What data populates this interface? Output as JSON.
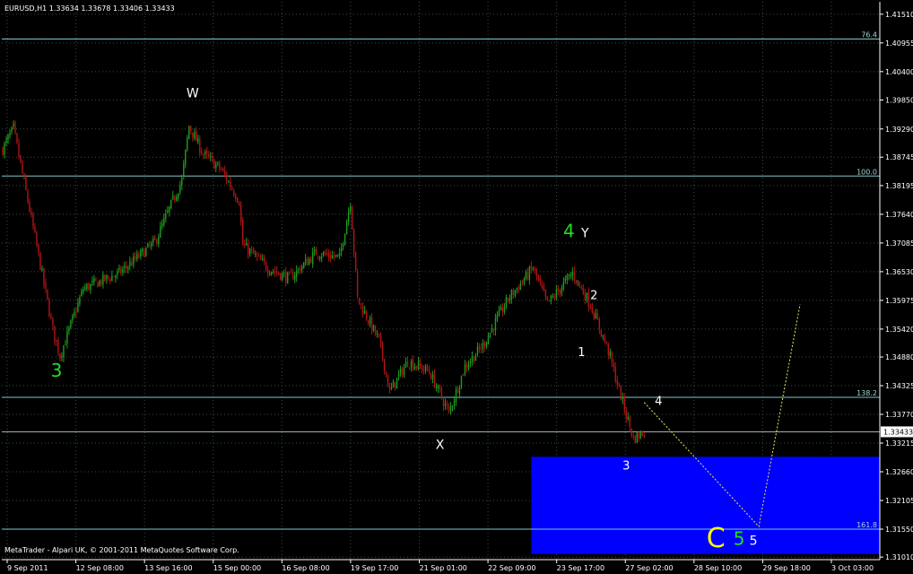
{
  "window": {
    "title": "EURUSD,H1  1.33634 1.33678 1.33406 1.33433",
    "copyright": "MetaTrader - Alpari UK, © 2001-2011 MetaQuotes Software Corp."
  },
  "colors": {
    "background": "#000000",
    "axis": "#ffffff",
    "grid": "#3a4a4a",
    "bull_candle": "#1e9c1e",
    "bear_candle": "#b01515",
    "fib_line": "#7fc8c8",
    "target_zone": "#0000ff",
    "projection": "#e8e860",
    "wave_green": "#22dd22",
    "wave_white": "#ffffff",
    "wave_yellow": "#ffff00"
  },
  "chart_data": {
    "type": "candlestick",
    "symbol": "EURUSD",
    "timeframe": "H1",
    "ylim": [
      1.3096,
      1.4175
    ],
    "y_ticks": [
      "1.41510",
      "1.40955",
      "1.40400",
      "1.39850",
      "1.39290",
      "1.38745",
      "1.38195",
      "1.37640",
      "1.37085",
      "1.36530",
      "1.35975",
      "1.35420",
      "1.34880",
      "1.34325",
      "1.33770",
      "1.33215",
      "1.32660",
      "1.32105",
      "1.31550",
      "1.31010"
    ],
    "x_ticks": [
      "9 Sep 2011",
      "12 Sep 08:00",
      "13 Sep 16:00",
      "15 Sep 00:00",
      "16 Sep 08:00",
      "19 Sep 17:00",
      "21 Sep 01:00",
      "22 Sep 09:00",
      "23 Sep 17:00",
      "27 Sep 02:00",
      "28 Sep 10:00",
      "29 Sep 18:00",
      "3 Oct 03:00"
    ],
    "current_price": "1.33433",
    "fib_levels": [
      {
        "label": "76.4",
        "price": 1.4103
      },
      {
        "label": "100.0",
        "price": 1.3838
      },
      {
        "label": "138.2",
        "price": 1.341
      },
      {
        "label": "161.8",
        "price": 1.3155
      }
    ],
    "target_zone": {
      "price_top": 1.3295,
      "price_bottom": 1.3107,
      "start_bar": 295
    },
    "anchors": [
      {
        "bar": 0,
        "price": 1.389
      },
      {
        "bar": 6,
        "price": 1.393
      },
      {
        "bar": 18,
        "price": 1.372
      },
      {
        "bar": 28,
        "price": 1.354
      },
      {
        "bar": 32,
        "price": 1.349
      },
      {
        "bar": 45,
        "price": 1.362
      },
      {
        "bar": 65,
        "price": 1.365
      },
      {
        "bar": 85,
        "price": 1.371
      },
      {
        "bar": 100,
        "price": 1.383
      },
      {
        "bar": 104,
        "price": 1.3935
      },
      {
        "bar": 112,
        "price": 1.388
      },
      {
        "bar": 122,
        "price": 1.385
      },
      {
        "bar": 132,
        "price": 1.379
      },
      {
        "bar": 134,
        "price": 1.3705
      },
      {
        "bar": 148,
        "price": 1.366
      },
      {
        "bar": 160,
        "price": 1.364
      },
      {
        "bar": 175,
        "price": 1.369
      },
      {
        "bar": 188,
        "price": 1.368
      },
      {
        "bar": 194,
        "price": 1.379
      },
      {
        "bar": 198,
        "price": 1.36
      },
      {
        "bar": 210,
        "price": 1.352
      },
      {
        "bar": 216,
        "price": 1.342
      },
      {
        "bar": 226,
        "price": 1.348
      },
      {
        "bar": 238,
        "price": 1.346
      },
      {
        "bar": 249,
        "price": 1.338
      },
      {
        "bar": 258,
        "price": 1.347
      },
      {
        "bar": 268,
        "price": 1.351
      },
      {
        "bar": 282,
        "price": 1.36
      },
      {
        "bar": 296,
        "price": 1.366
      },
      {
        "bar": 304,
        "price": 1.359
      },
      {
        "bar": 318,
        "price": 1.365
      },
      {
        "bar": 328,
        "price": 1.359
      },
      {
        "bar": 338,
        "price": 1.35
      },
      {
        "bar": 346,
        "price": 1.34
      },
      {
        "bar": 352,
        "price": 1.333
      },
      {
        "bar": 358,
        "price": 1.3343
      }
    ],
    "projection": [
      {
        "bar": 358,
        "price": 1.34
      },
      {
        "bar": 422,
        "price": 1.316
      },
      {
        "bar": 445,
        "price": 1.359
      }
    ],
    "wave_labels": [
      {
        "text": "3",
        "bar": 30,
        "price": 1.345,
        "color": "#22dd22",
        "size": 20
      },
      {
        "text": "W",
        "bar": 106,
        "price": 1.399,
        "color": "#ffffff",
        "size": 14
      },
      {
        "text": "X",
        "bar": 244,
        "price": 1.331,
        "color": "#ffffff",
        "size": 14
      },
      {
        "text": "4",
        "bar": 316,
        "price": 1.372,
        "color": "#22dd22",
        "size": 20
      },
      {
        "text": "Y",
        "bar": 325,
        "price": 1.372,
        "color": "#ffffff",
        "size": 14
      },
      {
        "text": "2",
        "bar": 330,
        "price": 1.36,
        "color": "#ffffff",
        "size": 13
      },
      {
        "text": "1",
        "bar": 323,
        "price": 1.349,
        "color": "#ffffff",
        "size": 13
      },
      {
        "text": "4",
        "bar": 366,
        "price": 1.3395,
        "color": "#ffffff",
        "size": 13
      },
      {
        "text": "3",
        "bar": 348,
        "price": 1.327,
        "color": "#ffffff",
        "size": 13
      },
      {
        "text": "C",
        "bar": 398,
        "price": 1.312,
        "color": "#ffff00",
        "size": 30
      },
      {
        "text": "5",
        "bar": 411,
        "price": 1.3125,
        "color": "#22dd22",
        "size": 20
      },
      {
        "text": "5",
        "bar": 419,
        "price": 1.3125,
        "color": "#ffffff",
        "size": 14
      }
    ]
  }
}
